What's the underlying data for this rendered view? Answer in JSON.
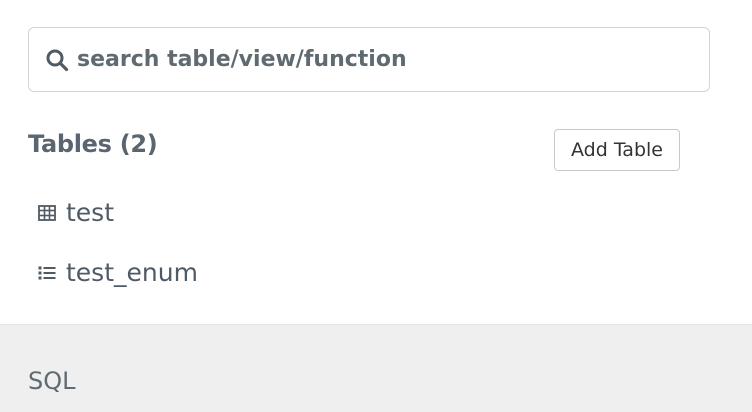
{
  "search": {
    "placeholder": "search table/view/function",
    "icon": "search-icon"
  },
  "tables_section": {
    "heading": "Tables (2)",
    "add_button_label": "Add Table",
    "items": [
      {
        "label": "test",
        "icon": "table-grid-icon"
      },
      {
        "label": "test_enum",
        "icon": "enum-list-icon"
      }
    ]
  },
  "sql_section": {
    "label": "SQL"
  },
  "colors": {
    "text_muted": "#5f6a71",
    "sql_bg": "#efefef",
    "border": "#d4d4d4"
  }
}
